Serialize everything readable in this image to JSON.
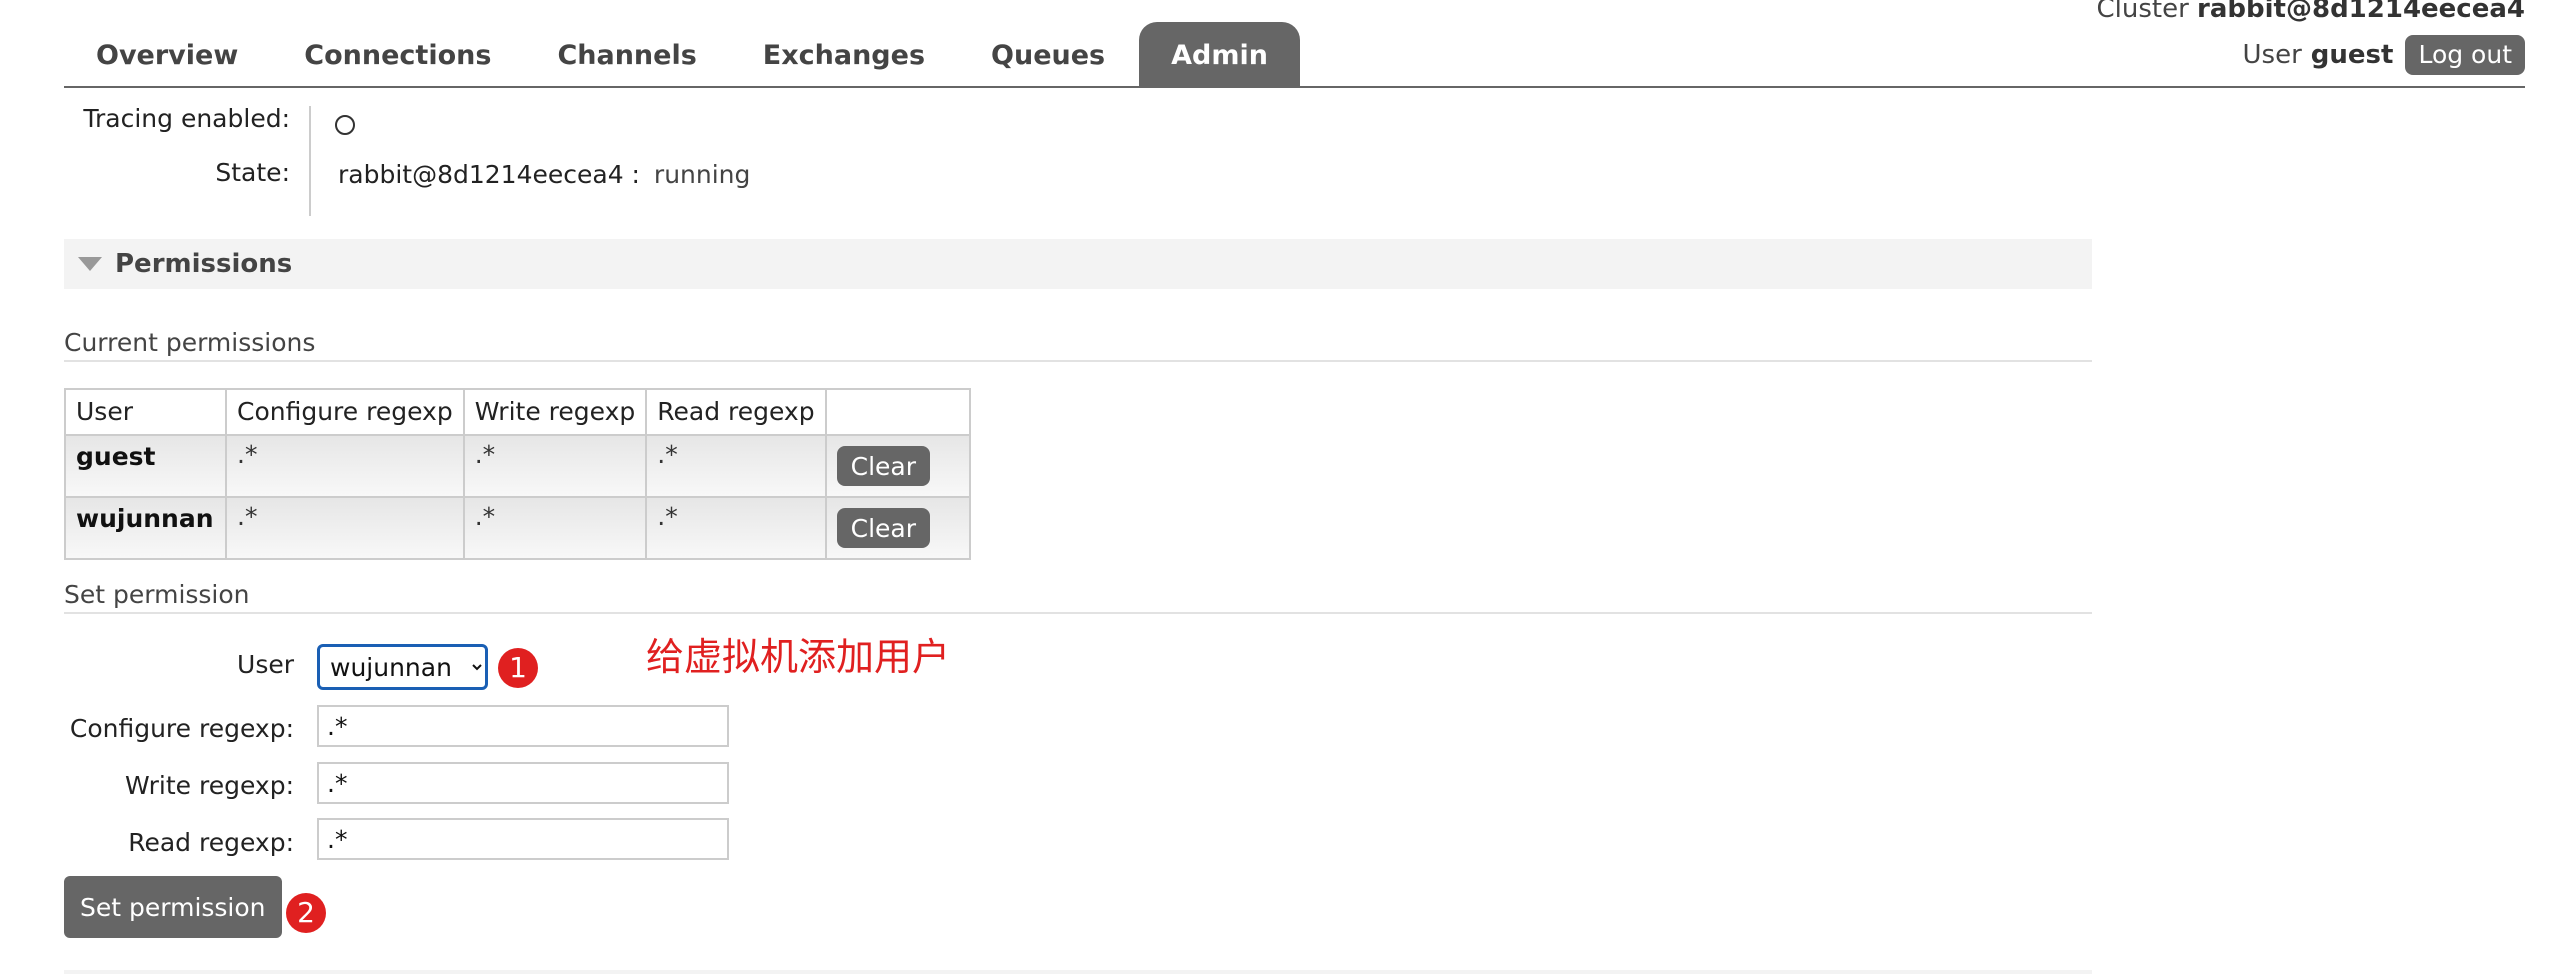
{
  "header": {
    "cluster_label": "Cluster",
    "cluster_name": "rabbit@8d1214eecea4",
    "user_label": "User",
    "user_name": "guest",
    "logout_label": "Log out",
    "tabs": [
      "Overview",
      "Connections",
      "Channels",
      "Exchanges",
      "Queues",
      "Admin"
    ],
    "active_tab": "Admin"
  },
  "info": {
    "tracing_label": "Tracing enabled:",
    "state_label": "State:",
    "state_node": "rabbit@8d1214eecea4 :",
    "state_value": "running"
  },
  "permissions": {
    "section_title": "Permissions",
    "current_title": "Current permissions",
    "columns": [
      "User",
      "Configure regexp",
      "Write regexp",
      "Read regexp"
    ],
    "rows": [
      {
        "user": "guest",
        "configure": ".*",
        "write": ".*",
        "read": ".*",
        "action": "Clear"
      },
      {
        "user": "wujunnan",
        "configure": ".*",
        "write": ".*",
        "read": ".*",
        "action": "Clear"
      }
    ]
  },
  "set_permission": {
    "title": "Set permission",
    "user_label": "User",
    "user_value": "wujunnan",
    "configure_label": "Configure regexp:",
    "configure_value": ".*",
    "write_label": "Write regexp:",
    "write_value": ".*",
    "read_label": "Read regexp:",
    "read_value": ".*",
    "submit_label": "Set permission"
  },
  "annotations": {
    "badge1": "1",
    "badge2": "2",
    "note": "给虚拟机添加用户",
    "color": "#e02020"
  }
}
